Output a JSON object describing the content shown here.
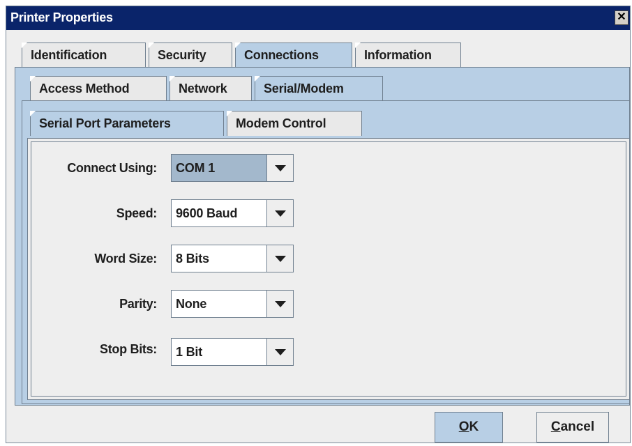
{
  "window": {
    "title": "Printer Properties",
    "close_glyph": "✕"
  },
  "tabs_level1": [
    "Identification",
    "Security",
    "Connections",
    "Information"
  ],
  "tabs_level2": [
    "Access Method",
    "Network",
    "Serial/Modem"
  ],
  "tabs_level3": [
    "Serial Port Parameters",
    "Modem Control"
  ],
  "selected": {
    "level1": "Connections",
    "level2": "Serial/Modem",
    "level3": "Serial Port Parameters"
  },
  "fields": {
    "connect_using": {
      "label": "Connect Using:",
      "value": "COM 1"
    },
    "speed": {
      "label": "Speed:",
      "value": "9600 Baud"
    },
    "word_size": {
      "label": "Word Size:",
      "value": "8 Bits"
    },
    "parity": {
      "label": "Parity:",
      "value": "None"
    },
    "stop_bits": {
      "label": "Stop Bits:",
      "value": "1 Bit"
    }
  },
  "buttons": {
    "ok": {
      "mnemonic": "O",
      "rest": "K"
    },
    "cancel": {
      "mnemonic": "C",
      "rest": "ancel"
    }
  },
  "icons": {
    "dropdown": "chevron-down-icon",
    "close": "close-icon"
  },
  "colors": {
    "title_bar": "#0a246a",
    "selected_tab": "#b8cfe5",
    "panel": "#eeeeee",
    "highlight": "#a3b8cc"
  }
}
